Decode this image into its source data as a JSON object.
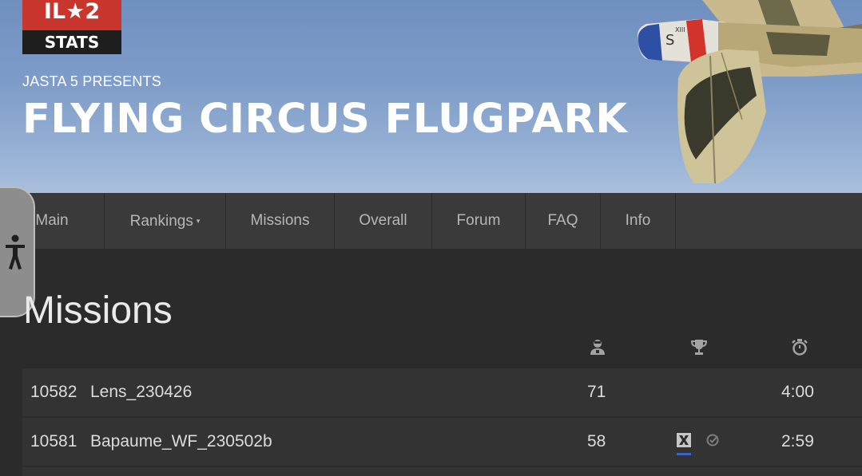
{
  "header": {
    "logo_top": "IL★2",
    "logo_bottom": "STATS",
    "presents": "JASTA 5 PRESENTS",
    "title": "FLYING CIRCUS FLUGPARK",
    "plane_marking": "XIII"
  },
  "nav": {
    "items": [
      {
        "label": "Main"
      },
      {
        "label": "Rankings",
        "has_dropdown": true,
        "caret": "▾"
      },
      {
        "label": "Missions"
      },
      {
        "label": "Overall"
      },
      {
        "label": "Forum"
      },
      {
        "label": "FAQ"
      },
      {
        "label": "Info"
      }
    ]
  },
  "accessibility": {
    "icon": "accessibility-icon"
  },
  "page": {
    "heading": "Missions"
  },
  "table": {
    "column_icons": [
      "players-icon",
      "trophy-icon",
      "stopwatch-icon"
    ],
    "rows": [
      {
        "id": "10582",
        "name": "Lens_230426",
        "players": "71",
        "winner": null,
        "duration": "4:00"
      },
      {
        "id": "10581",
        "name": "Bapaume_WF_230502b",
        "players": "58",
        "winner": [
          "iron-cross-icon",
          "check-icon"
        ],
        "duration": "2:59"
      }
    ]
  },
  "colors": {
    "background": "#2b2b2b",
    "navbar": "#3a3a3a",
    "row": "#333333",
    "logo_red": "#c8362e",
    "winner_underline": "#3d63c9"
  }
}
